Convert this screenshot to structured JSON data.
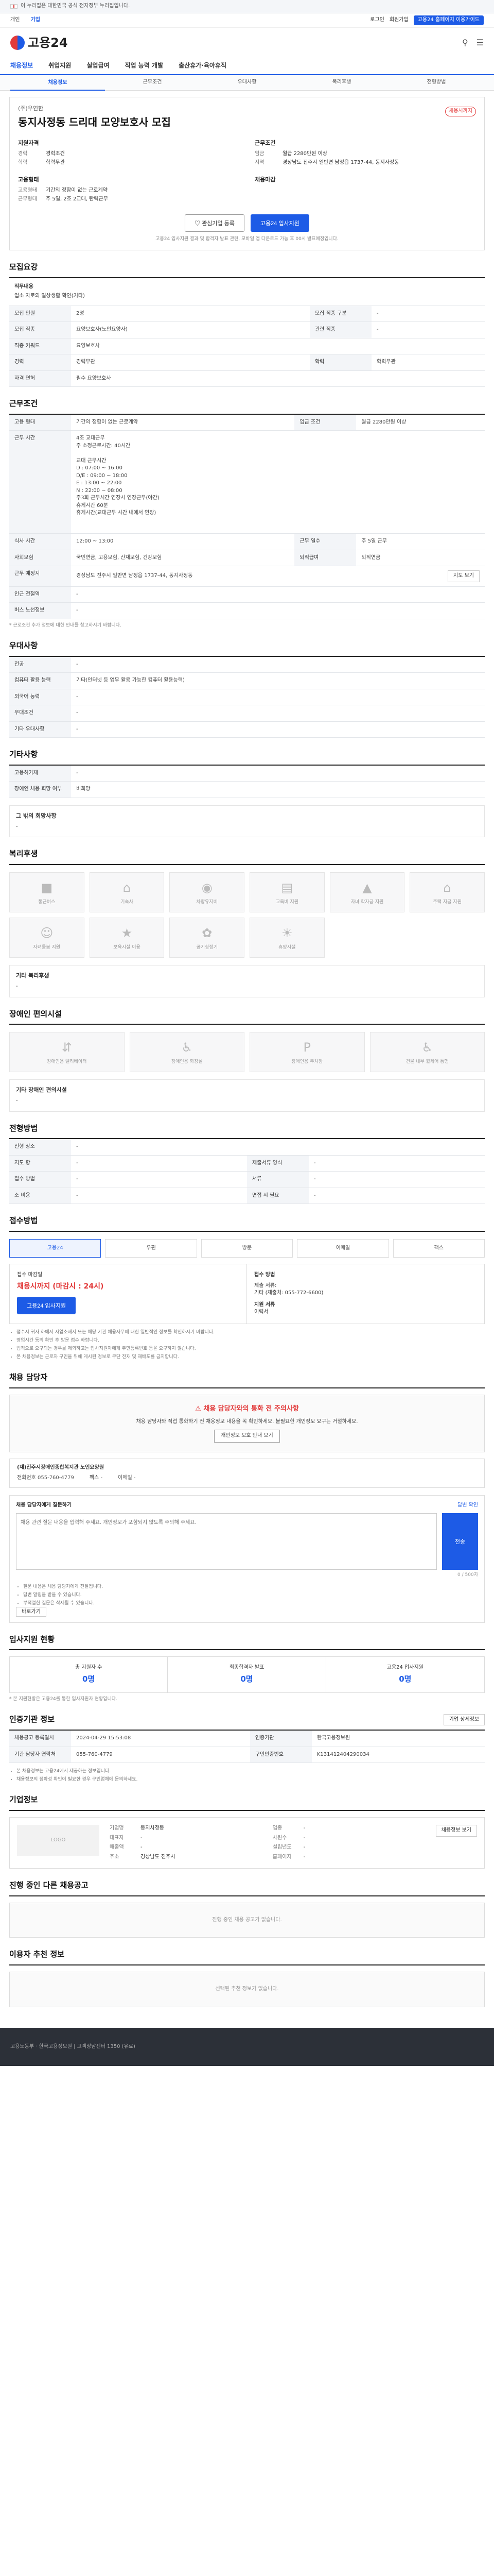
{
  "gov_notice": "이 누리집은 대한민국 공식 전자정부 누리집입니다.",
  "topbar": {
    "links": [
      "개인",
      "기업"
    ],
    "active_index": 1,
    "right_items": [
      "로그인",
      "회원가입"
    ],
    "badge": "고용24 홈페이지 이용가이드"
  },
  "brand": {
    "name": "고용24"
  },
  "gnb": [
    "채용정보",
    "취업지원",
    "실업급여",
    "직업 능력 개발",
    "출산휴가·육아휴직"
  ],
  "snb": [
    "채용정보",
    "근무조건",
    "우대사항",
    "복리후생",
    "전형방법"
  ],
  "job": {
    "company": "(주)우연한",
    "title": "동지사정동 드리대 모양보호사 모집",
    "tag": "채용시까지",
    "blocks": [
      {
        "h": "지원자격",
        "rows": [
          [
            "경력",
            "경력조건"
          ],
          [
            "학력",
            "학력무관"
          ]
        ]
      },
      {
        "h": "근무조건",
        "rows": [
          [
            "임금",
            "월급 2280만원 이상"
          ],
          [
            "지역",
            "경상남도 진주시 일반면 남정읍 1737-44, 동지사정동"
          ]
        ]
      },
      {
        "h": "고용형태",
        "rows": [
          [
            "고용형태",
            "기간의 정함이 없는 근로계약"
          ],
          [
            "근무형태",
            "주 5일, 2조 2교대, 탄력근무"
          ]
        ]
      },
      {
        "h": "채용마감",
        "rows": []
      }
    ],
    "btn_scrap": "관심기업 등록",
    "btn_apply": "고용24 입사지원",
    "note": "고용24 입사지원 결과 및 합격자 발표 관련, 모바일 앱 다운로드 가능 후 00시 발표예정입니다."
  },
  "recruit": {
    "title": "모집요강",
    "duty_h": "직무내용",
    "duty": "업소 자로의 일상생활 확인(기타)",
    "rows": [
      [
        "모집 인원",
        "2명",
        "모집 직종 구분",
        "-"
      ],
      [
        "모집 직종",
        "요양보호사(노인요양사)",
        "관련 직종",
        "-"
      ],
      [
        "직종 키워드",
        "요양보호사",
        "",
        ""
      ],
      [
        "경력",
        "경력무관",
        "학력",
        "학력무관"
      ],
      [
        "자격 면허",
        "필수 요양보호사",
        "",
        ""
      ]
    ]
  },
  "work": {
    "title": "근무조건",
    "rows": [
      [
        "고용 형태",
        "기간의 정함이 없는 근로계약",
        "임금 조건",
        "월급 2280만원 이상"
      ],
      [
        "",
        "",
        "",
        ""
      ],
      [
        "근무 시간",
        "4조 교대근무\n주 소정근로시간: 40시간\n\n교대 근무시간\nD : 07:00 ~ 16:00\nD/E : 09:00 ~ 18:00\nE : 13:00 ~ 22:00\nN : 22:00 ~ 08:00\n주3회 근무시간 연장시 연장근무(야간)\n휴게시간 60분\n휴게시간(교대근무 시간 내에서 연장)",
        "",
        ""
      ],
      [
        "식사 시간",
        "12:00 ~ 13:00",
        "근무 일수",
        "주 5일 근무"
      ],
      [
        "사회보험",
        "국민연금, 고용보험, 산재보험, 건강보험",
        "퇴직급여",
        "퇴직연금"
      ],
      [
        "근무 예정지",
        "경상남도 진주시 일반면 남정읍 1737-44, 동지사정동",
        "",
        ""
      ],
      [
        "인근 전철역",
        "-",
        "",
        ""
      ],
      [
        "버스 노선정보",
        "-",
        "",
        ""
      ]
    ],
    "note": "* 근로조건 추가 정보에 대한 안내를 참고하시기 바랍니다.",
    "map_btn": "지도 보기"
  },
  "pref": {
    "title": "우대사항",
    "rows": [
      [
        "전공",
        "-"
      ],
      [
        "컴퓨터 활용 능력",
        "기타(인터넷 등 업무 활용 가능한 컴퓨터 활용능력)"
      ],
      [
        "외국어 능력",
        "-"
      ],
      [
        "우대조건",
        "-"
      ],
      [
        "기타 우대사항",
        "-"
      ]
    ]
  },
  "etc": {
    "title": "기타사항",
    "rows": [
      [
        "고용허가제",
        "-"
      ],
      [
        "장애인 채용 희망 여부",
        "비희망"
      ]
    ],
    "sub_h": "그 밖의 회망사항",
    "sub_v": "-"
  },
  "welfare": {
    "title": "복리후생",
    "items": [
      "통근버스",
      "기숙사",
      "차량유지비",
      "교육비 지원",
      "자녀 학자금 지원",
      "주택 자금 지원",
      "자녀돌봄 지원",
      "보육시설 이용",
      "공기청정기",
      "휴양시설"
    ],
    "sub_h": "기타 복리후생",
    "sub_v": "-"
  },
  "facility": {
    "title": "장애인 편의시설",
    "items": [
      "장애인용 엘리베이터",
      "장애인용 화장실",
      "장애인용 주차장",
      "건물 내부 휠체어 통행"
    ],
    "sub_h": "기타 장애인 편의시설",
    "sub_v": "-"
  },
  "process": {
    "title": "전형방법",
    "rows": [
      [
        "전형 장소",
        "-",
        "",
        ""
      ],
      [
        "지도 항",
        "-",
        "제출서류 양식",
        "-"
      ],
      [
        "접수 방법",
        "-",
        "서류",
        "-"
      ],
      [
        "소 비용",
        "-",
        "면접 시 필요",
        "-"
      ]
    ]
  },
  "apply": {
    "title": "접수방법",
    "methods": [
      "고용24",
      "우편",
      "방문",
      "이메일",
      "팩스"
    ],
    "active": 0,
    "left_h": "접수 마감일",
    "left_v": "채용시까지 (마감시 : 24시)",
    "left_btn": "고용24 입사지원",
    "right_h": "접수 방법",
    "right_rows": [
      "제출 서류:",
      "기타 (제출처: 055-772-6600)",
      "지원 서류",
      "이력서"
    ],
    "bullets": [
      "접수시 귀사 하에서 사업소재지 또는 해당 기관 채용사무에 대한 일반적인 정보를 확인하시기 바랍니다.",
      "영업시간 등의 확인 후 방문 접수 바랍니다.",
      "법적으로 요구되는 경우를 제외하고는 입사지원자에게 주민등록번호 등을 요구하지 않습니다.",
      "본 채용정보는 근로자 구인을 위해 게시된 정보로 무단 전재 및 재배포를 금지합니다."
    ]
  },
  "manager": {
    "title": "채용 담당자",
    "warn": "채용 담당자와의 통화 전 주의사항",
    "warn_text": "채용 담당자와 직접 통화하기 전 채용정보 내용을 꼭 확인하세요. 불필요한 개인정보 요구는 거절하세요.",
    "warn_btn": "개인정보 보호 안내 보기",
    "org": "(재)진주시장애인종합복지관 노인요양원",
    "phone_label": "전화번호",
    "phone": "055-760-4779",
    "fax_label": "팩스",
    "fax": "-",
    "email_label": "이메일",
    "email": "-"
  },
  "qa": {
    "title": "채용 담당자에게 질문하기",
    "right": "답변 확인",
    "placeholder": "채용 관련 질문 내용을 입력해 주세요. 개인정보가 포함되지 않도록 주의해 주세요.",
    "send": "전송",
    "count": "0 / 500자",
    "bullets": [
      "질문 내용은 채용 담당자에게 전달됩니다.",
      "답변 알림을 받을 수 있습니다.",
      "부적절한 질문은 삭제될 수 있습니다."
    ],
    "btn": "바로가기"
  },
  "status": {
    "title": "입사지원 현황",
    "items": [
      [
        "총 지원자 수",
        "0명"
      ],
      [
        "최종합격자 발표",
        "0명"
      ],
      [
        "고용24 입사지원",
        "0명"
      ]
    ],
    "note": "* 본 지원현황은 고용24를 통한 입사지원자 현황입니다."
  },
  "info": {
    "title": "인증기관 정보",
    "btn": "기업 상세정보",
    "rows": [
      [
        "채용공고 등록일시",
        "2024-04-29 15:53:08",
        "인증기관",
        "한국고용정보원"
      ],
      [
        "기관 담당자 연락처",
        "055-760-4779",
        "구인인증번호",
        "K131412404290034"
      ]
    ],
    "bullets": [
      "본 채용정보는 고용24에서 제공하는 정보입니다.",
      "채용정보의 정확성 확인이 필요한 경우 구인업체에 문의하세요."
    ]
  },
  "company": {
    "title": "기업정보",
    "logo": "LOGO",
    "rows": [
      [
        "기업명",
        "동지사정동",
        "업종",
        "-"
      ],
      [
        "대표자",
        "-",
        "사원수",
        "-"
      ],
      [
        "매출액",
        "-",
        "설립년도",
        "-"
      ],
      [
        "주소",
        "경상남도 진주시",
        "홈페이지",
        "-"
      ]
    ],
    "btn": "채용정보 보기"
  },
  "similar": {
    "title": "진행 중인 다른 채용공고",
    "empty": "진행 중인 채용 공고가 없습니다."
  },
  "recommend": {
    "title": "이용자 추천 정보",
    "empty": "선택된 추천 정보가 없습니다."
  },
  "footer": {
    "text": "고용노동부 · 한국고용정보원 | 고객상담센터 1350 (유료)"
  }
}
